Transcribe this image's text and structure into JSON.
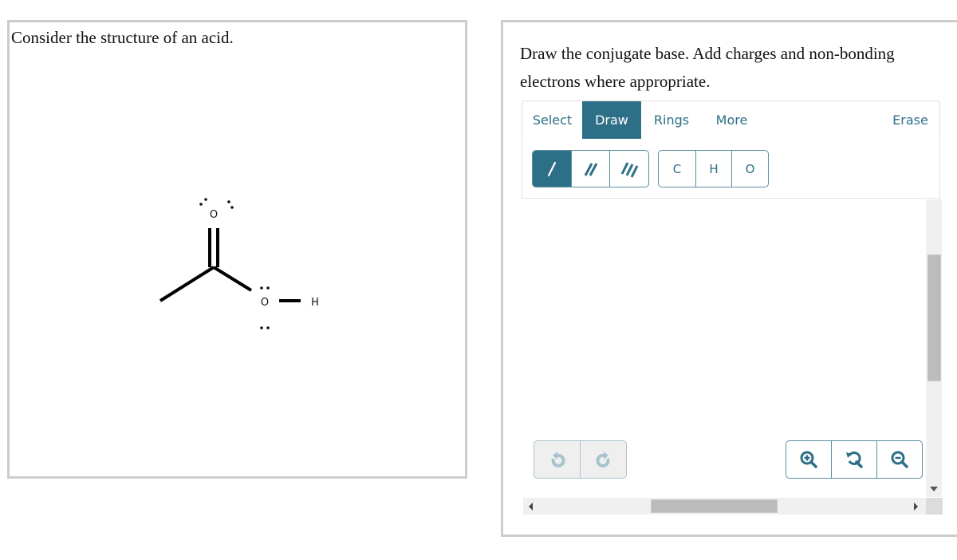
{
  "question": {
    "prompt": "Consider the structure of an acid.",
    "structure": {
      "name": "acetic acid",
      "atoms": [
        {
          "id": "carbonyl-oxygen",
          "symbol": "O",
          "lone_pairs": 2,
          "charge": 0
        },
        {
          "id": "hydroxyl-oxygen",
          "symbol": "O",
          "lone_pairs": 2,
          "charge": 0
        },
        {
          "id": "hydroxyl-hydrogen",
          "symbol": "H",
          "lone_pairs": 0,
          "charge": 0
        }
      ],
      "bonds": [
        {
          "from": "methyl-carbon",
          "to": "carbonyl-carbon",
          "order": 1
        },
        {
          "from": "carbonyl-carbon",
          "to": "carbonyl-oxygen",
          "order": 2
        },
        {
          "from": "carbonyl-carbon",
          "to": "hydroxyl-oxygen",
          "order": 1
        },
        {
          "from": "hydroxyl-oxygen",
          "to": "hydroxyl-hydrogen",
          "order": 1
        }
      ]
    }
  },
  "answer": {
    "prompt": "Draw the conjugate base. Add charges and non-bonding electrons where appropriate.",
    "editor": {
      "tabs": [
        {
          "label": "Select",
          "active": false
        },
        {
          "label": "Draw",
          "active": true
        },
        {
          "label": "Rings",
          "active": false
        },
        {
          "label": "More",
          "active": false
        }
      ],
      "erase_label": "Erase",
      "bond_tools": [
        {
          "name": "single-bond",
          "icon": "single-bond-icon",
          "active": true
        },
        {
          "name": "double-bond",
          "icon": "double-bond-icon",
          "active": false
        },
        {
          "name": "triple-bond",
          "icon": "triple-bond-icon",
          "active": false
        }
      ],
      "atom_tools": [
        "C",
        "H",
        "O"
      ],
      "undo": {
        "icon": "undo-icon",
        "enabled": false
      },
      "redo": {
        "icon": "redo-icon",
        "enabled": false
      },
      "zoom_controls": [
        {
          "name": "zoom-in",
          "icon": "zoom-in-icon"
        },
        {
          "name": "zoom-reset",
          "icon": "zoom-reset-icon"
        },
        {
          "name": "zoom-out",
          "icon": "zoom-out-icon"
        }
      ]
    }
  },
  "colors": {
    "accent": "#2e6f88",
    "disabled_icon": "#a9c3cd",
    "panel_border": "#cccccc"
  }
}
